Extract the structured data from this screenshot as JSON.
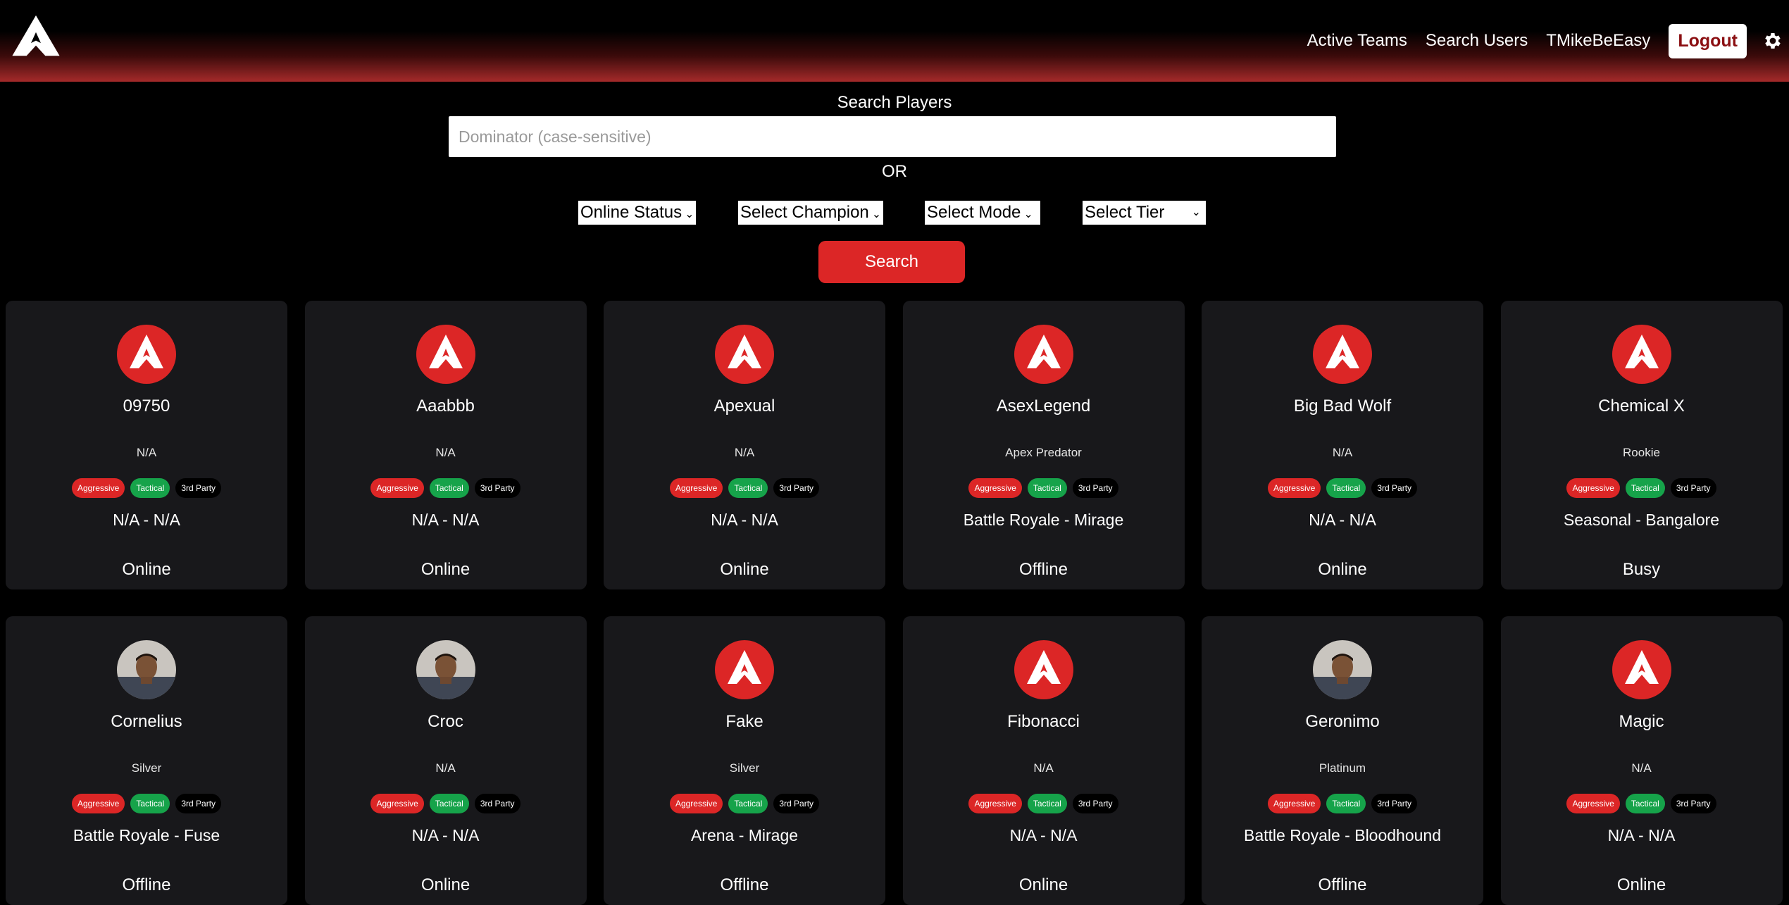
{
  "nav": {
    "links": [
      "Active Teams",
      "Search Users",
      "TMikeBeEasy"
    ],
    "logout": "Logout"
  },
  "search": {
    "title": "Search Players",
    "placeholder": "Dominator (case-sensitive)",
    "or": "OR",
    "filters": [
      "Online Status",
      "Select Champion",
      "Select Mode",
      "Select Tier"
    ],
    "button": "Search"
  },
  "tags": {
    "aggressive": "Aggressive",
    "tactical": "Tactical",
    "third_party": "3rd Party"
  },
  "colors": {
    "accent": "#dc2626",
    "tactical": "#16a34a",
    "card": "#18181b"
  },
  "players": [
    {
      "name": "09750",
      "tier": "N/A",
      "mode": "N/A - N/A",
      "status": "Online",
      "avatar": "apex-logo-icon"
    },
    {
      "name": "Aaabbb",
      "tier": "N/A",
      "mode": "N/A - N/A",
      "status": "Online",
      "avatar": "apex-logo-icon"
    },
    {
      "name": "Apexual",
      "tier": "N/A",
      "mode": "N/A - N/A",
      "status": "Online",
      "avatar": "apex-logo-icon"
    },
    {
      "name": "AsexLegend",
      "tier": "Apex Predator",
      "mode": "Battle Royale - Mirage",
      "status": "Offline",
      "avatar": "apex-logo-icon"
    },
    {
      "name": "Big Bad Wolf",
      "tier": "N/A",
      "mode": "N/A - N/A",
      "status": "Online",
      "avatar": "apex-logo-icon"
    },
    {
      "name": "Chemical X",
      "tier": "Rookie",
      "mode": "Seasonal - Bangalore",
      "status": "Busy",
      "avatar": "apex-logo-icon"
    },
    {
      "name": "Cornelius",
      "tier": "Silver",
      "mode": "Battle Royale - Fuse",
      "status": "Offline",
      "avatar": "user-photo"
    },
    {
      "name": "Croc",
      "tier": "N/A",
      "mode": "N/A - N/A",
      "status": "Online",
      "avatar": "user-photo"
    },
    {
      "name": "Fake",
      "tier": "Silver",
      "mode": "Arena - Mirage",
      "status": "Offline",
      "avatar": "apex-logo-icon"
    },
    {
      "name": "Fibonacci",
      "tier": "N/A",
      "mode": "N/A - N/A",
      "status": "Online",
      "avatar": "apex-logo-icon"
    },
    {
      "name": "Geronimo",
      "tier": "Platinum",
      "mode": "Battle Royale - Bloodhound",
      "status": "Offline",
      "avatar": "user-photo"
    },
    {
      "name": "Magic",
      "tier": "N/A",
      "mode": "N/A - N/A",
      "status": "Online",
      "avatar": "apex-logo-icon"
    }
  ]
}
